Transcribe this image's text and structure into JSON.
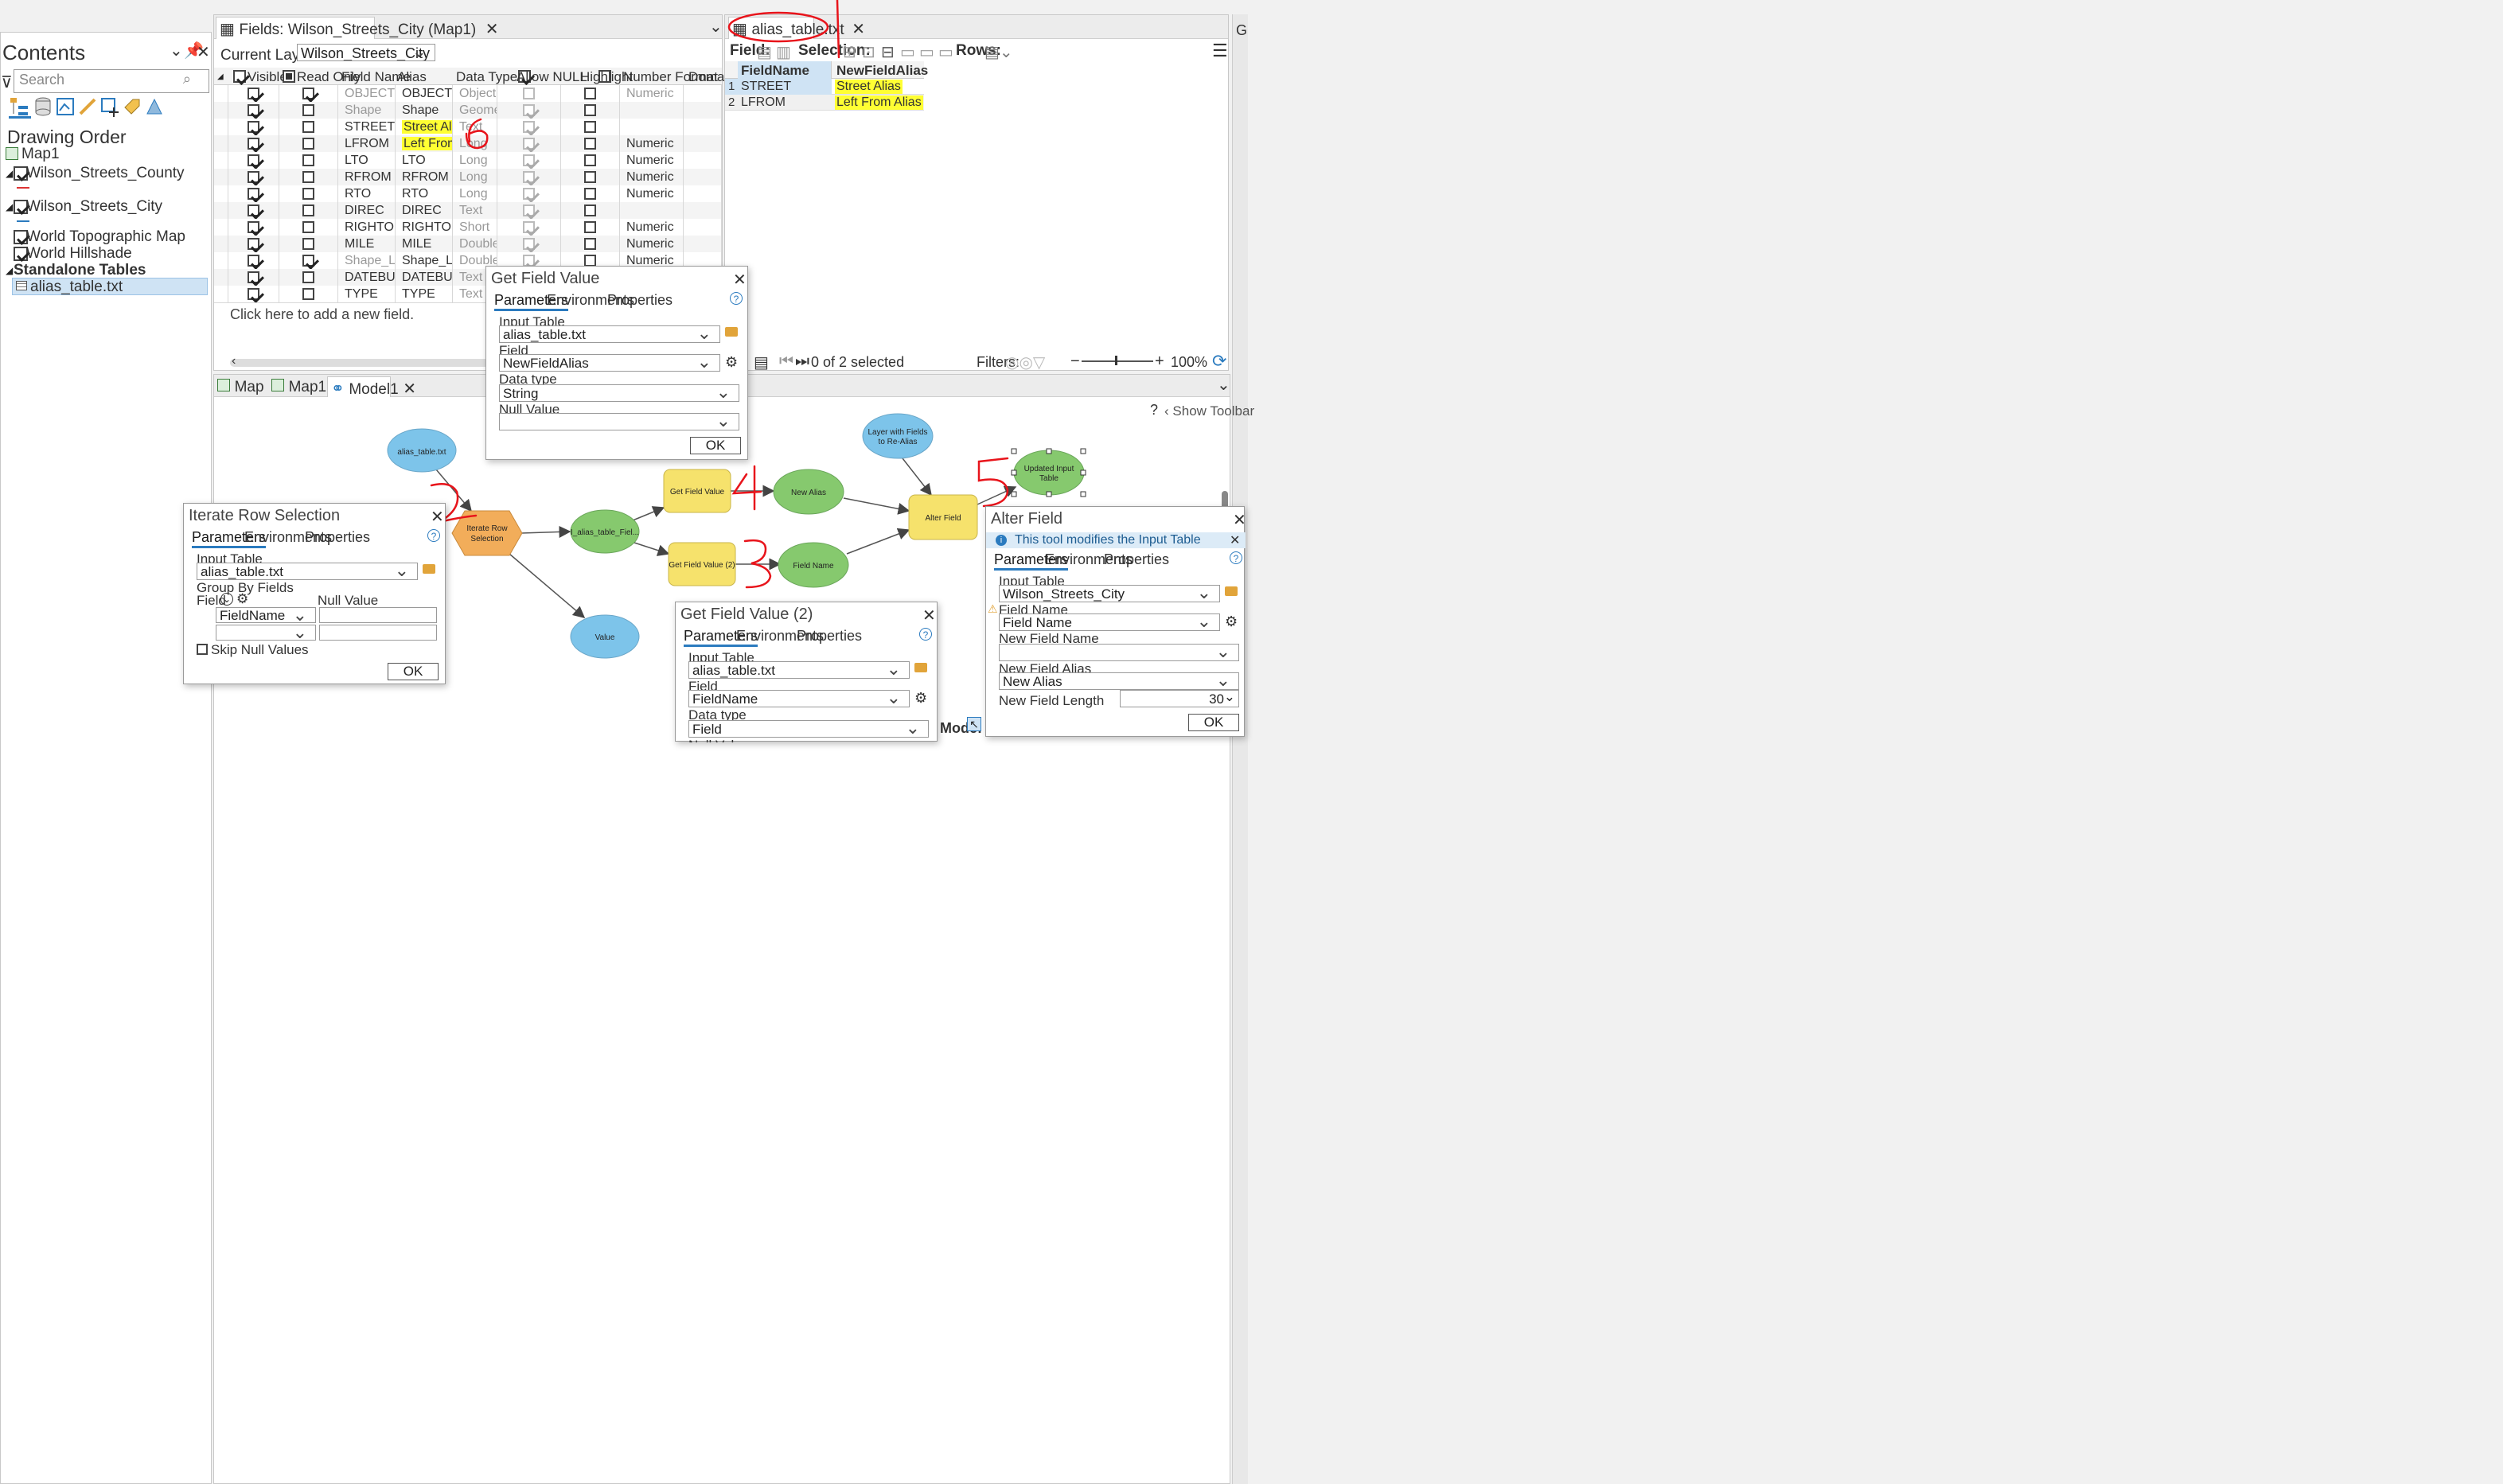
{
  "contents": {
    "title": "Contents",
    "search_placeholder": "Search",
    "section": "Drawing Order",
    "map": "Map1",
    "layers": [
      "Wilson_Streets_County",
      "Wilson_Streets_City",
      "World Topographic Map",
      "World Hillshade"
    ],
    "standalone_header": "Standalone Tables",
    "table_item": "alias_table.txt"
  },
  "fields_view": {
    "tab_title": "Fields: Wilson_Streets_City (Map1)",
    "current_layer_label": "Current Layer",
    "current_layer_value": "Wilson_Streets_City (Map1)",
    "headers": [
      "Visible",
      "Read Only",
      "Field Name",
      "Alias",
      "Data Type",
      "Allow NULL",
      "Highlight",
      "Number Format",
      "Domain"
    ],
    "rows": [
      {
        "visible": true,
        "readonly": true,
        "name": "OBJECTID",
        "alias": "OBJECTID",
        "type": "Object ID",
        "allow_null": false,
        "highlight": false,
        "format": "Numeric",
        "muted": true
      },
      {
        "visible": true,
        "readonly": false,
        "name": "Shape",
        "alias": "Shape",
        "type": "Geometry",
        "allow_null": true,
        "highlight": false,
        "format": "",
        "muted": true
      },
      {
        "visible": true,
        "readonly": false,
        "name": "STREET",
        "alias": "Street Alias",
        "type": "Text",
        "allow_null": true,
        "highlight": false,
        "format": "",
        "muted": false,
        "alias_hl": true
      },
      {
        "visible": true,
        "readonly": false,
        "name": "LFROM",
        "alias": "Left From Alias",
        "type": "Long",
        "allow_null": true,
        "highlight": false,
        "format": "Numeric",
        "muted": false,
        "alias_hl": true
      },
      {
        "visible": true,
        "readonly": false,
        "name": "LTO",
        "alias": "LTO",
        "type": "Long",
        "allow_null": true,
        "highlight": false,
        "format": "Numeric",
        "muted": false
      },
      {
        "visible": true,
        "readonly": false,
        "name": "RFROM",
        "alias": "RFROM",
        "type": "Long",
        "allow_null": true,
        "highlight": false,
        "format": "Numeric",
        "muted": false
      },
      {
        "visible": true,
        "readonly": false,
        "name": "RTO",
        "alias": "RTO",
        "type": "Long",
        "allow_null": true,
        "highlight": false,
        "format": "Numeric",
        "muted": false
      },
      {
        "visible": true,
        "readonly": false,
        "name": "DIREC",
        "alias": "DIREC",
        "type": "Text",
        "allow_null": true,
        "highlight": false,
        "format": "",
        "muted": false
      },
      {
        "visible": true,
        "readonly": false,
        "name": "RIGHTOFWAY",
        "alias": "RIGHTOFWAY",
        "type": "Short",
        "allow_null": true,
        "highlight": false,
        "format": "Numeric",
        "muted": false
      },
      {
        "visible": true,
        "readonly": false,
        "name": "MILE",
        "alias": "MILE",
        "type": "Double",
        "allow_null": true,
        "highlight": false,
        "format": "Numeric",
        "muted": false
      },
      {
        "visible": true,
        "readonly": true,
        "name": "Shape_Length",
        "alias": "Shape_Length",
        "type": "Double",
        "allow_null": true,
        "highlight": false,
        "format": "Numeric",
        "muted": true
      },
      {
        "visible": true,
        "readonly": false,
        "name": "DATEBUILT",
        "alias": "DATEBUILT",
        "type": "Text",
        "allow_null": true,
        "highlight": false,
        "format": "",
        "muted": false
      },
      {
        "visible": true,
        "readonly": false,
        "name": "TYPE",
        "alias": "TYPE",
        "type": "Text",
        "allow_null": true,
        "highlight": false,
        "format": "",
        "muted": false
      }
    ],
    "add_field": "Click here to add a new field."
  },
  "alias_table": {
    "tab_title": "alias_table.txt",
    "toolbar": {
      "field": "Field:",
      "selection": "Selection:",
      "rows": "Rows:"
    },
    "headers": [
      "FieldName",
      "NewFieldAlias"
    ],
    "rows": [
      {
        "n": "1",
        "field": "STREET",
        "alias": "Street Alias"
      },
      {
        "n": "2",
        "field": "LFROM",
        "alias": "Left From Alias"
      }
    ],
    "status": "0 of 2 selected",
    "filters": "Filters:",
    "zoom": "100%"
  },
  "bottom_tabs": [
    "Map",
    "Map1",
    "Model1"
  ],
  "model": {
    "show_toolbar": "Show Toolbar",
    "mode": "Mode:",
    "nodes": {
      "alias_table": "alias_table.txt",
      "iterate": "Iterate Row Selection",
      "i_alias": "I_alias_table_Fiel...",
      "value": "Value",
      "gfv1": "Get Field Value",
      "gfv2": "Get Field Value (2)",
      "new_alias": "New Alias",
      "field_name": "Field Name",
      "layer": "Layer with Fields to Re-Alias",
      "alter": "Alter Field",
      "updated": "Updated Input Table"
    },
    "annotations": [
      "1",
      "2",
      "3",
      "4",
      "5",
      "6"
    ]
  },
  "dialogs": {
    "tabs": [
      "Parameters",
      "Environments",
      "Properties"
    ],
    "ok": "OK",
    "get_field_value": {
      "title": "Get Field Value",
      "input_table_label": "Input Table",
      "input_table": "alias_table.txt",
      "field_label": "Field",
      "field": "NewFieldAlias",
      "data_type_label": "Data type",
      "data_type": "String",
      "null_label": "Null Value",
      "null_value": ""
    },
    "iterate": {
      "title": "Iterate Row Selection",
      "input_table_label": "Input Table",
      "input_table": "alias_table.txt",
      "group_label": "Group By Fields",
      "field_col": "Field",
      "null_col": "Null Value",
      "field_value": "FieldName",
      "skip_null": "Skip Null Values"
    },
    "get_field_value_2": {
      "title": "Get Field Value (2)",
      "input_table_label": "Input Table",
      "input_table": "alias_table.txt",
      "field_label": "Field",
      "field": "FieldName",
      "data_type_label": "Data type",
      "data_type": "Field",
      "null_label": "Null Value"
    },
    "alter_field": {
      "title": "Alter Field",
      "info": "This tool modifies the Input Table",
      "input_table_label": "Input Table",
      "input_table": "Wilson_Streets_City",
      "field_name_label": "Field Name",
      "field_name": "Field Name",
      "new_name_label": "New Field Name",
      "new_name": "",
      "new_alias_label": "New Field Alias",
      "new_alias": "New Alias",
      "length_label": "New Field Length",
      "length": "30"
    }
  },
  "colors": {
    "accent": "#2b7bbf",
    "highlight": "#ffff33",
    "annotation": "#e8141b",
    "data_node": "#7dc4ea",
    "tool_node": "#f6e26c",
    "output_node": "#86c96e",
    "iterator": "#f2ad5a"
  }
}
